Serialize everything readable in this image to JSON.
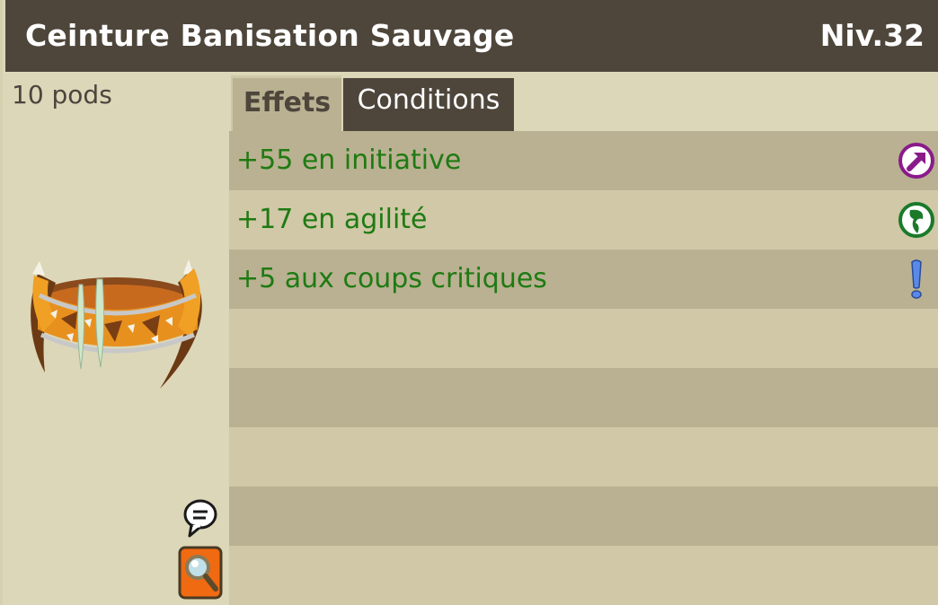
{
  "header": {
    "title": "Ceinture Banisation Sauvage",
    "level": "Niv.32"
  },
  "item": {
    "weight": "10 pods",
    "image_icon": "belt-item-icon"
  },
  "tabs": [
    {
      "label": "Effets",
      "active": true
    },
    {
      "label": "Conditions",
      "active": false
    }
  ],
  "effects": [
    {
      "text": "+55 en initiative",
      "icon": "initiative-icon"
    },
    {
      "text": "+17 en agilité",
      "icon": "agility-icon"
    },
    {
      "text": "+5 aux coups critiques",
      "icon": "critical-icon"
    }
  ],
  "actions": {
    "chat_icon": "speech-bubble-icon",
    "search_icon": "magnifier-icon"
  },
  "colors": {
    "header_bg": "#4e463b",
    "panel_bg": "#dcd7b8",
    "row_dark": "#b9b191",
    "row_light": "#d0c8a6",
    "effect_text": "#1f7a12"
  }
}
